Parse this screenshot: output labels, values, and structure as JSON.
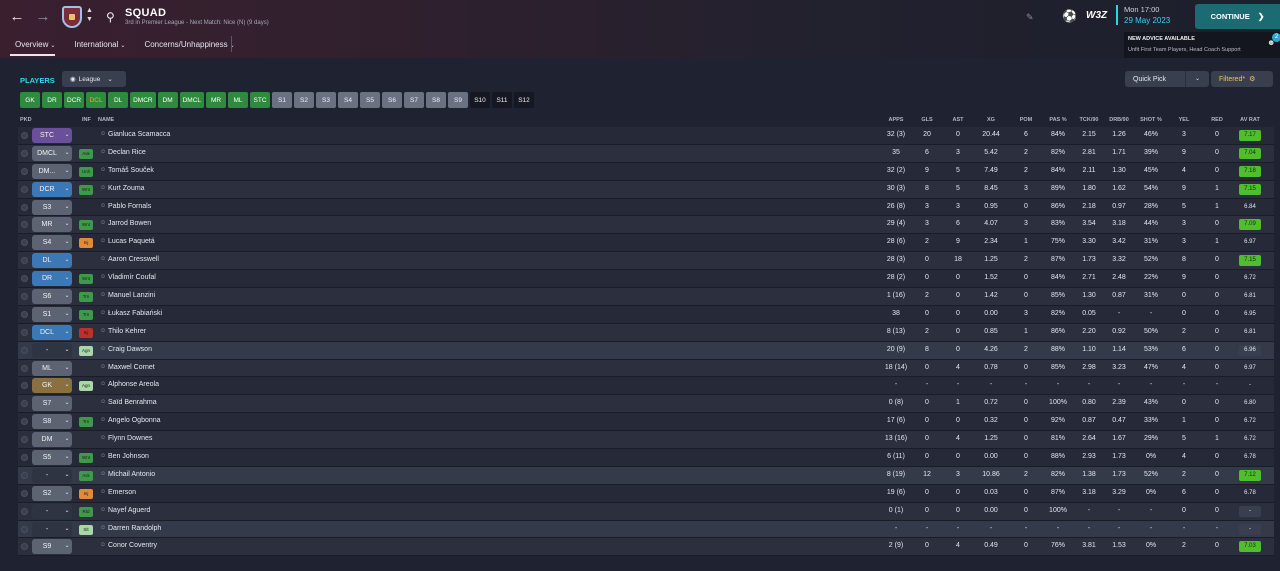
{
  "header": {
    "title": "SQUAD",
    "subtitle": "3rd in Premier League - Next Match: Nice (N) (9 days)",
    "tabs": [
      {
        "label": "Overview"
      },
      {
        "label": "International"
      },
      {
        "label": "Concerns/Unhappiness"
      }
    ],
    "time": "Mon 17:00",
    "date": "29 May 2023",
    "continue_label": "CONTINUE",
    "brand": "W3Z"
  },
  "advice": {
    "title": "NEW ADVICE AVAILABLE",
    "text": "Unfit First Team Players, Head Coach Support",
    "count": "2"
  },
  "toolbar": {
    "players_label": "PLAYERS",
    "league_label": "League",
    "quick_pick_label": "Quick Pick",
    "filtered_label": "Filtered*"
  },
  "position_chips": [
    {
      "label": "GK",
      "style": "g"
    },
    {
      "label": "DR",
      "style": "g"
    },
    {
      "label": "DCR",
      "style": "g"
    },
    {
      "label": "DCL",
      "style": "go"
    },
    {
      "label": "DL",
      "style": "g"
    },
    {
      "label": "DMCR",
      "style": "g"
    },
    {
      "label": "DM",
      "style": "g"
    },
    {
      "label": "DMCL",
      "style": "g"
    },
    {
      "label": "MR",
      "style": "g"
    },
    {
      "label": "ML",
      "style": "g"
    },
    {
      "label": "STC",
      "style": "g"
    },
    {
      "label": "S1",
      "style": "s"
    },
    {
      "label": "S2",
      "style": "s"
    },
    {
      "label": "S3",
      "style": "s"
    },
    {
      "label": "S4",
      "style": "s"
    },
    {
      "label": "S5",
      "style": "s"
    },
    {
      "label": "S6",
      "style": "s"
    },
    {
      "label": "S7",
      "style": "s"
    },
    {
      "label": "S8",
      "style": "s"
    },
    {
      "label": "S9",
      "style": "s"
    },
    {
      "label": "S10",
      "style": "d"
    },
    {
      "label": "S11",
      "style": "d"
    },
    {
      "label": "S12",
      "style": "d"
    }
  ],
  "table": {
    "headers": {
      "pkd": "PKD",
      "inf": "INF",
      "name": "NAME",
      "apps": "APPS",
      "gls": "GLS",
      "ast": "AST",
      "xg": "XG",
      "pom": "POM",
      "pas": "PAS %",
      "tck": "TCK/90",
      "drb": "DRB/90",
      "shot": "SHOT %",
      "yel": "YEL",
      "red": "RED",
      "avrat": "AV RAT"
    },
    "rows": [
      {
        "pos": "STC",
        "posColor": "#6a4f9a",
        "inf": "",
        "infColor": "",
        "name": "Gianluca Scamacca",
        "apps": "32 (3)",
        "gls": "20",
        "ast": "0",
        "xg": "20.44",
        "pom": "6",
        "pas": "84%",
        "tck": "2.15",
        "drb": "1.26",
        "shot": "46%",
        "yel": "3",
        "red": "0",
        "rat": "7.17",
        "ratStyle": "green",
        "hl": false
      },
      {
        "pos": "DMCL",
        "posColor": "#5c6474",
        "inf": "Ask",
        "infColor": "#3e9a4a",
        "name": "Declan Rice",
        "apps": "35",
        "gls": "6",
        "ast": "3",
        "xg": "5.42",
        "pom": "2",
        "pas": "82%",
        "tck": "2.81",
        "drb": "1.71",
        "shot": "39%",
        "yel": "9",
        "red": "0",
        "rat": "7.04",
        "ratStyle": "green",
        "hl": false
      },
      {
        "pos": "DM...",
        "posColor": "#5c6474",
        "inf": "Unh",
        "infColor": "#3e9a4a",
        "name": "Tomáš Souček",
        "apps": "32 (2)",
        "gls": "9",
        "ast": "5",
        "xg": "7.49",
        "pom": "2",
        "pas": "84%",
        "tck": "2.11",
        "drb": "1.30",
        "shot": "45%",
        "yel": "4",
        "red": "0",
        "rat": "7.18",
        "ratStyle": "green",
        "hl": false
      },
      {
        "pos": "DCR",
        "posColor": "#3c78b5",
        "inf": "Wnt",
        "infColor": "#3e9a4a",
        "name": "Kurt Zouma",
        "apps": "30 (3)",
        "gls": "8",
        "ast": "5",
        "xg": "8.45",
        "pom": "3",
        "pas": "89%",
        "tck": "1.80",
        "drb": "1.62",
        "shot": "54%",
        "yel": "9",
        "red": "1",
        "rat": "7.15",
        "ratStyle": "green",
        "hl": false
      },
      {
        "pos": "S3",
        "posColor": "#5c6474",
        "inf": "",
        "infColor": "",
        "name": "Pablo Fornals",
        "apps": "26 (8)",
        "gls": "3",
        "ast": "3",
        "xg": "0.95",
        "pom": "0",
        "pas": "86%",
        "tck": "2.18",
        "drb": "0.97",
        "shot": "28%",
        "yel": "5",
        "red": "1",
        "rat": "6.84",
        "ratStyle": "plain",
        "hl": false
      },
      {
        "pos": "MR",
        "posColor": "#5c6474",
        "inf": "Wnt",
        "infColor": "#3e9a4a",
        "name": "Jarrod Bowen",
        "apps": "29 (4)",
        "gls": "3",
        "ast": "6",
        "xg": "4.07",
        "pom": "3",
        "pas": "83%",
        "tck": "3.54",
        "drb": "3.18",
        "shot": "44%",
        "yel": "3",
        "red": "0",
        "rat": "7.09",
        "ratStyle": "green",
        "hl": false
      },
      {
        "pos": "S4",
        "posColor": "#5c6474",
        "inf": "Inj",
        "infColor": "#e08a3a",
        "name": "Lucas Paquetá",
        "apps": "28 (6)",
        "gls": "2",
        "ast": "9",
        "xg": "2.34",
        "pom": "1",
        "pas": "75%",
        "tck": "3.30",
        "drb": "3.42",
        "shot": "31%",
        "yel": "3",
        "red": "1",
        "rat": "6.97",
        "ratStyle": "plain",
        "hl": false
      },
      {
        "pos": "DL",
        "posColor": "#3c78b5",
        "inf": "",
        "infColor": "",
        "name": "Aaron Cresswell",
        "apps": "28 (3)",
        "gls": "0",
        "ast": "18",
        "xg": "1.25",
        "pom": "2",
        "pas": "87%",
        "tck": "1.73",
        "drb": "3.32",
        "shot": "52%",
        "yel": "8",
        "red": "0",
        "rat": "7.15",
        "ratStyle": "green",
        "hl": false
      },
      {
        "pos": "DR",
        "posColor": "#3c78b5",
        "inf": "Wnt",
        "infColor": "#3e9a4a",
        "name": "Vladimír Coufal",
        "apps": "28 (2)",
        "gls": "0",
        "ast": "0",
        "xg": "1.52",
        "pom": "0",
        "pas": "84%",
        "tck": "2.71",
        "drb": "2.48",
        "shot": "22%",
        "yel": "9",
        "red": "0",
        "rat": "6.72",
        "ratStyle": "plain",
        "hl": false
      },
      {
        "pos": "S6",
        "posColor": "#5c6474",
        "inf": "Trn",
        "infColor": "#3e9a4a",
        "name": "Manuel Lanzini",
        "apps": "1 (16)",
        "gls": "2",
        "ast": "0",
        "xg": "1.42",
        "pom": "0",
        "pas": "85%",
        "tck": "1.30",
        "drb": "0.87",
        "shot": "31%",
        "yel": "0",
        "red": "0",
        "rat": "6.81",
        "ratStyle": "plain",
        "hl": false
      },
      {
        "pos": "S1",
        "posColor": "#5c6474",
        "inf": "Trn",
        "infColor": "#3e9a4a",
        "name": "Łukasz Fabiański",
        "apps": "38",
        "gls": "0",
        "ast": "0",
        "xg": "0.00",
        "pom": "3",
        "pas": "82%",
        "tck": "0.05",
        "drb": "-",
        "shot": "-",
        "yel": "0",
        "red": "0",
        "rat": "6.95",
        "ratStyle": "plain",
        "hl": false
      },
      {
        "pos": "DCL",
        "posColor": "#3c78b5",
        "inf": "Inj",
        "infColor": "#c0302a",
        "name": "Thilo Kehrer",
        "apps": "8 (13)",
        "gls": "2",
        "ast": "0",
        "xg": "0.85",
        "pom": "1",
        "pas": "86%",
        "tck": "2.20",
        "drb": "0.92",
        "shot": "50%",
        "yel": "2",
        "red": "0",
        "rat": "6.81",
        "ratStyle": "plain",
        "hl": false
      },
      {
        "pos": "-",
        "posColor": "#2f3443",
        "inf": "Agn",
        "infColor": "#a8d8a8",
        "name": "Craig Dawson",
        "apps": "20 (9)",
        "gls": "8",
        "ast": "0",
        "xg": "4.26",
        "pom": "2",
        "pas": "88%",
        "tck": "1.10",
        "drb": "1.14",
        "shot": "53%",
        "yel": "6",
        "red": "0",
        "rat": "6.96",
        "ratStyle": "none",
        "hl": true
      },
      {
        "pos": "ML",
        "posColor": "#5c6474",
        "inf": "",
        "infColor": "",
        "name": "Maxwel Cornet",
        "apps": "18 (14)",
        "gls": "0",
        "ast": "4",
        "xg": "0.78",
        "pom": "0",
        "pas": "85%",
        "tck": "2.98",
        "drb": "3.23",
        "shot": "47%",
        "yel": "4",
        "red": "0",
        "rat": "6.97",
        "ratStyle": "plain",
        "hl": false
      },
      {
        "pos": "GK",
        "posColor": "#8a7040",
        "inf": "Agn",
        "infColor": "#a8d8a8",
        "name": "Alphonse Areola",
        "apps": "-",
        "gls": "-",
        "ast": "-",
        "xg": "-",
        "pom": "-",
        "pas": "-",
        "tck": "-",
        "drb": "-",
        "shot": "-",
        "yel": "-",
        "red": "-",
        "rat": "-",
        "ratStyle": "plain",
        "hl": false
      },
      {
        "pos": "S7",
        "posColor": "#5c6474",
        "inf": "",
        "infColor": "",
        "name": "Saïd Benrahma",
        "apps": "0 (8)",
        "gls": "0",
        "ast": "1",
        "xg": "0.72",
        "pom": "0",
        "pas": "100%",
        "tck": "0.80",
        "drb": "2.39",
        "shot": "43%",
        "yel": "0",
        "red": "0",
        "rat": "6.80",
        "ratStyle": "plain",
        "hl": false
      },
      {
        "pos": "S8",
        "posColor": "#5c6474",
        "inf": "Trn",
        "infColor": "#3e9a4a",
        "name": "Angelo Ogbonna",
        "apps": "17 (6)",
        "gls": "0",
        "ast": "0",
        "xg": "0.32",
        "pom": "0",
        "pas": "92%",
        "tck": "0.87",
        "drb": "0.47",
        "shot": "33%",
        "yel": "1",
        "red": "0",
        "rat": "6.72",
        "ratStyle": "plain",
        "hl": false
      },
      {
        "pos": "DM",
        "posColor": "#5c6474",
        "inf": "",
        "infColor": "",
        "name": "Flynn Downes",
        "apps": "13 (16)",
        "gls": "0",
        "ast": "4",
        "xg": "1.25",
        "pom": "0",
        "pas": "81%",
        "tck": "2.64",
        "drb": "1.67",
        "shot": "29%",
        "yel": "5",
        "red": "1",
        "rat": "6.72",
        "ratStyle": "plain",
        "hl": false
      },
      {
        "pos": "S5",
        "posColor": "#5c6474",
        "inf": "Wnt",
        "infColor": "#3e9a4a",
        "name": "Ben Johnson",
        "apps": "6 (11)",
        "gls": "0",
        "ast": "0",
        "xg": "0.00",
        "pom": "0",
        "pas": "88%",
        "tck": "2.93",
        "drb": "1.73",
        "shot": "0%",
        "yel": "4",
        "red": "0",
        "rat": "6.78",
        "ratStyle": "plain",
        "hl": false
      },
      {
        "pos": "-",
        "posColor": "#2f3443",
        "inf": "Ask",
        "infColor": "#3e9a4a",
        "name": "Michail Antonio",
        "apps": "8 (19)",
        "gls": "12",
        "ast": "3",
        "xg": "10.86",
        "pom": "2",
        "pas": "82%",
        "tck": "1.38",
        "drb": "1.73",
        "shot": "52%",
        "yel": "2",
        "red": "0",
        "rat": "7.12",
        "ratStyle": "green",
        "hl": true
      },
      {
        "pos": "S2",
        "posColor": "#5c6474",
        "inf": "Inj",
        "infColor": "#e08a3a",
        "name": "Emerson",
        "apps": "19 (6)",
        "gls": "0",
        "ast": "0",
        "xg": "0.03",
        "pom": "0",
        "pas": "87%",
        "tck": "3.18",
        "drb": "3.29",
        "shot": "0%",
        "yel": "6",
        "red": "0",
        "rat": "6.78",
        "ratStyle": "plain",
        "hl": false
      },
      {
        "pos": "-",
        "posColor": "#2f3443",
        "inf": "Rtd",
        "infColor": "#3e9a4a",
        "name": "Nayef Aguerd",
        "apps": "0 (1)",
        "gls": "0",
        "ast": "0",
        "xg": "0.00",
        "pom": "0",
        "pas": "100%",
        "tck": "-",
        "drb": "-",
        "shot": "-",
        "yel": "0",
        "red": "0",
        "rat": "-",
        "ratStyle": "none",
        "hl": false
      },
      {
        "pos": "-",
        "posColor": "#2f3443",
        "inf": "Slt",
        "infColor": "#a8d8a8",
        "name": "Darren Randolph",
        "apps": "-",
        "gls": "-",
        "ast": "-",
        "xg": "-",
        "pom": "-",
        "pas": "-",
        "tck": "-",
        "drb": "-",
        "shot": "-",
        "yel": "-",
        "red": "-",
        "rat": "-",
        "ratStyle": "none",
        "hl": true
      },
      {
        "pos": "S9",
        "posColor": "#5c6474",
        "inf": "",
        "infColor": "",
        "name": "Conor Coventry",
        "apps": "2 (9)",
        "gls": "0",
        "ast": "4",
        "xg": "0.49",
        "pom": "0",
        "pas": "76%",
        "tck": "3.81",
        "drb": "1.53",
        "shot": "0%",
        "yel": "2",
        "red": "0",
        "rat": "7.03",
        "ratStyle": "green",
        "hl": false
      }
    ]
  }
}
